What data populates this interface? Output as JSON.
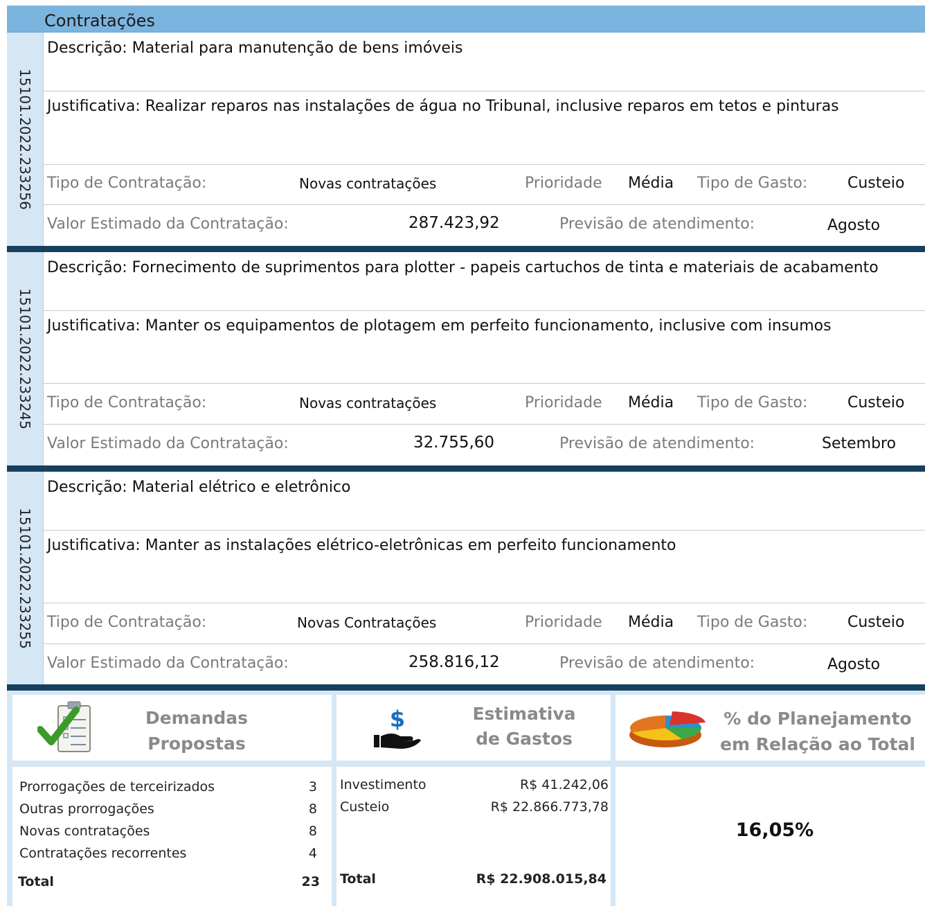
{
  "header": {
    "title": "Contratações"
  },
  "labels": {
    "tipo_contratacao": "Tipo de Contratação:",
    "prioridade": "Prioridade",
    "tipo_gasto": "Tipo de Gasto:",
    "valor_estimado": "Valor Estimado da Contratação:",
    "previsao": "Previsão de atendimento:"
  },
  "contracts": [
    {
      "id": "15101.2022.233256",
      "descricao": "Descrição: Material para manutenção de bens imóveis",
      "justificativa": "Justificativa: Realizar reparos nas instalações de água no Tribunal, inclusive reparos em tetos e pinturas",
      "tipo_contratacao": "Novas contratações",
      "prioridade": "Média",
      "tipo_gasto": "Custeio",
      "valor": "287.423,92",
      "previsao": "Agosto"
    },
    {
      "id": "15101.2022.233245",
      "descricao": "Descrição: Fornecimento de suprimentos para plotter - papeis cartuchos de tinta e materiais de acabamento",
      "justificativa": "Justificativa: Manter os equipamentos de plotagem em perfeito funcionamento, inclusive com insumos",
      "tipo_contratacao": "Novas contratações",
      "prioridade": "Média",
      "tipo_gasto": "Custeio",
      "valor": "32.755,60",
      "previsao": "Setembro"
    },
    {
      "id": "15101.2022.233255",
      "descricao": "Descrição: Material elétrico e eletrônico",
      "justificativa": "Justificativa: Manter as instalações elétrico-eletrônicas em perfeito funcionamento",
      "tipo_contratacao": "Novas Contratações",
      "prioridade": "Média",
      "tipo_gasto": "Custeio",
      "valor": "258.816,12",
      "previsao": "Agosto"
    }
  ],
  "summary": {
    "demandas": {
      "title_line1": "Demandas",
      "title_line2": "Propostas",
      "icon": "checklist-icon",
      "rows": [
        {
          "label": "Prorrogações de terceirizados",
          "value": "3"
        },
        {
          "label": "Outras prorrogações",
          "value": "8"
        },
        {
          "label": "Novas contratações",
          "value": "8"
        },
        {
          "label": "Contratações recorrentes",
          "value": "4"
        }
      ],
      "total_label": "Total",
      "total_value": "23"
    },
    "estimativa": {
      "title_line1": "Estimativa",
      "title_line2": "de Gastos",
      "icon": "money-hand-icon",
      "rows": [
        {
          "label": "Investimento",
          "value": "R$ 41.242,06"
        },
        {
          "label": "Custeio",
          "value": "R$ 22.866.773,78"
        }
      ],
      "total_label": "Total",
      "total_value": "R$ 22.908.015,84"
    },
    "percentual": {
      "title_line1": "% do Planejamento",
      "title_line2": "em Relação ao Total",
      "icon": "pie-chart-icon",
      "value": "16,05%"
    }
  },
  "colors": {
    "header": "#7cb4e0",
    "separator": "#16415e",
    "side": "#d5e6f5"
  }
}
